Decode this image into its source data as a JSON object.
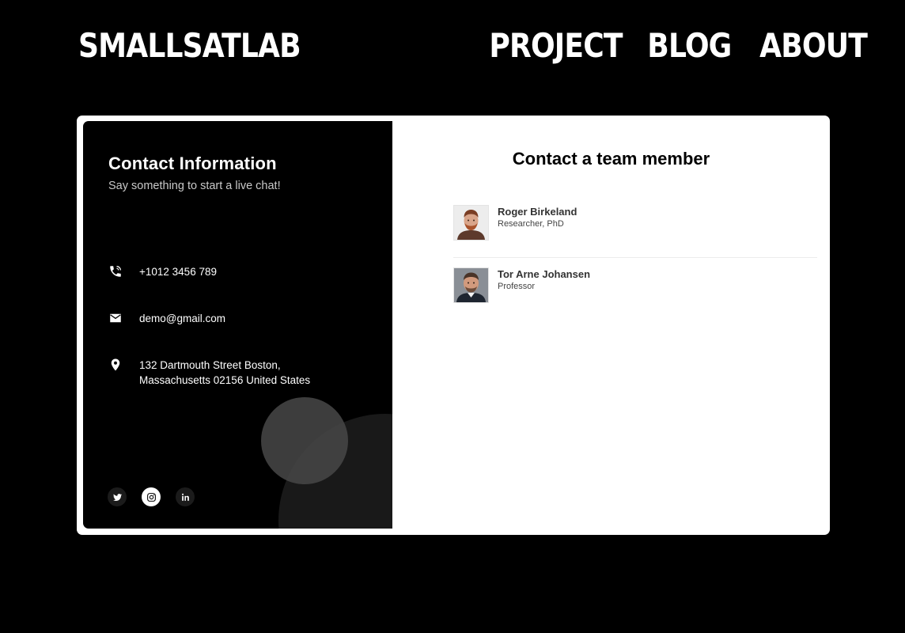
{
  "header": {
    "brand": "SMALLSATLAB",
    "nav": [
      "PROJECT",
      "BLOG",
      "ABOUT"
    ]
  },
  "contact_info": {
    "title": "Contact Information",
    "subtitle": "Say something to start a live chat!",
    "phone": "+1012 3456 789",
    "email": "demo@gmail.com",
    "address": "132 Dartmouth Street Boston, Massachusetts 02156 United States",
    "socials": [
      "twitter-icon",
      "instagram-icon",
      "linkedin-icon"
    ]
  },
  "team": {
    "title": "Contact a team member",
    "members": [
      {
        "name": "Roger Birkeland",
        "role": "Researcher, PhD"
      },
      {
        "name": "Tor Arne Johansen",
        "role": "Professor"
      }
    ]
  },
  "colors": {
    "background": "#000000",
    "card": "#ffffff",
    "accent_text": "#ffffff"
  }
}
